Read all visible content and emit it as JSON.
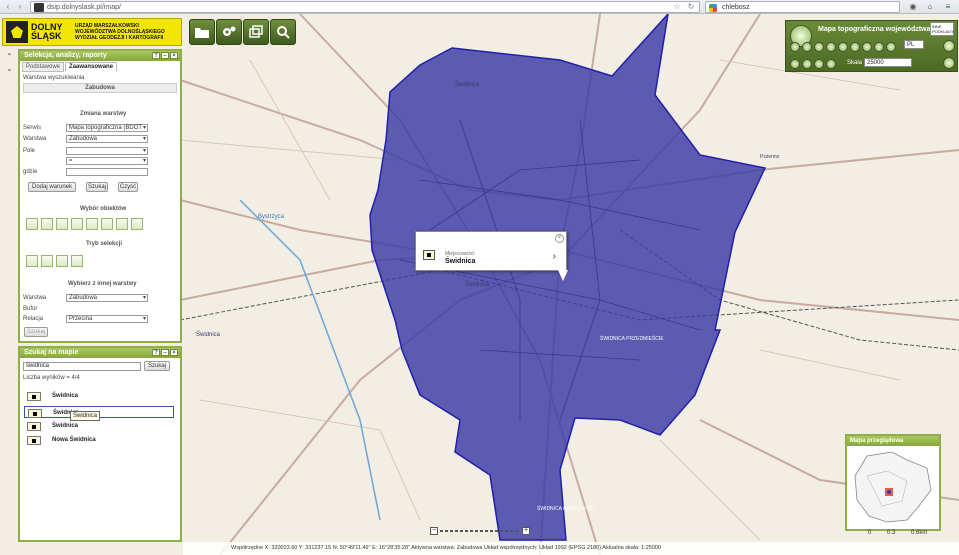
{
  "browser": {
    "url": "dsip.dolnyslask.pl/imap/",
    "search_text": "chlebosz"
  },
  "logo": {
    "name": "DOLNY ŚLĄSK",
    "office": "URZĄD MARSZAŁKOWSKI WOJEWÓDZTWA DOLNOŚLĄSKIEGO WYDZIAŁ GEODEZJI I KARTOGRAFII"
  },
  "selection_panel": {
    "title": "Selekcja, analizy, raporty",
    "tabs": [
      "Podstawowe",
      "Zaawansowane"
    ],
    "layer_hint": "Warstwa wyszukiwania",
    "layer_name": "Zabudowa",
    "conditions_header": "Zmiana warstwy",
    "serwis_label": "Serwis",
    "serwis_value": "Mapa topograficzna (BDOT",
    "warstwa_label": "Warstwa",
    "warstwa_value": "Zabudowa",
    "pole_label": "Pole",
    "pole_value": "",
    "operator_value": "=",
    "value_label": "gdzie",
    "value_value": "",
    "add_condition": "Dodaj warunek",
    "search_btn": "Szukaj",
    "clear_btn": "Czyść",
    "object_select_header": "Wybór obiektów",
    "select_mode_header": "Tryb selekcji",
    "other_layer_header": "Wybierz z innej warstwy",
    "other_warstwa_label": "Warstwa",
    "other_warstwa_value": "Zabudowa",
    "bufor_label": "Bufor",
    "relacja_label": "Relacja",
    "relacja_value": "Przecina",
    "bottom_btn": "Szukaj"
  },
  "search_panel": {
    "title": "Szukaj na mapie",
    "query": "świdnica",
    "search_btn": "Szukaj",
    "result_count": "Liczba wyników = 4/4",
    "results": [
      "Świdnica",
      "Świdnica",
      "Świdnica",
      "Nowa Świdnica"
    ],
    "tooltip": "Świdnica"
  },
  "popup": {
    "category": "Miejscowości",
    "name": "Świdnica"
  },
  "layer_panel": {
    "title": "Mapa topograficzna województwa",
    "dropdown": "INNE PODKŁADY",
    "lang": "PL",
    "scale_label": "Skala",
    "scale_value": "25000"
  },
  "overview": {
    "title": "Mapa przeglądowa",
    "scale_ticks": [
      "0",
      "0.3",
      "0.6km"
    ]
  },
  "status": {
    "text": "Współrzędne X: 320023.60 Y: 331237.15   N: 50°49'11.49\" E: 16°28'35.28\"   Aktywna warstwa: Zabudowa   Układ współrzędnych: Układ 1992 (EPSG 2180)   Aktualna skala: 1:25000"
  },
  "map_labels": {
    "town": "Świdnica",
    "station": "ŚWIDNICA PRZEDMIEŚCIE",
    "south": "ŚWIDNICA KOSZOWICE",
    "east": "Pszenno",
    "north": "Świdnica",
    "river": "Bystrzyca",
    "west_town": "Świdnica"
  },
  "colors": {
    "polygon_fill": "#3a3aa6",
    "panel_green": "#8fae4a"
  }
}
